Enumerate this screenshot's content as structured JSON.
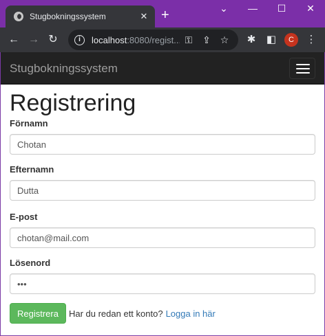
{
  "browser": {
    "tab_title": "Stugbokningssystem",
    "tab_close": "✕",
    "new_tab": "+",
    "url_host": "localhost",
    "url_rest": ":8080/regist...",
    "profile_initial": "C",
    "window_controls": {
      "minimize": "—",
      "maximize": "☐",
      "close": "✕"
    },
    "icons": [
      "back-arrow-icon",
      "forward-arrow-icon",
      "reload-icon",
      "info-icon",
      "key-icon",
      "share-icon",
      "star-icon",
      "extensions-icon",
      "sidepanel-icon",
      "menu-dots-icon"
    ]
  },
  "navbar": {
    "brand": "Stugbokningssystem"
  },
  "form": {
    "heading": "Registrering",
    "fields": [
      {
        "label": "Förnamn",
        "value": "Chotan",
        "type": "text"
      },
      {
        "label": "Efternamn",
        "value": "Dutta",
        "type": "text"
      },
      {
        "label": "E-post",
        "value": "chotan@mail.com",
        "type": "email"
      },
      {
        "label": "Lösenord",
        "value": "•••",
        "type": "password"
      }
    ],
    "submit_label": "Registrera",
    "login_prompt": "Har du redan ett konto?",
    "login_link": "Logga in här"
  },
  "colors": {
    "titlebar": "#7b2fa8",
    "navbar": "#222222",
    "submit": "#5cb85c",
    "link": "#337ab7"
  }
}
